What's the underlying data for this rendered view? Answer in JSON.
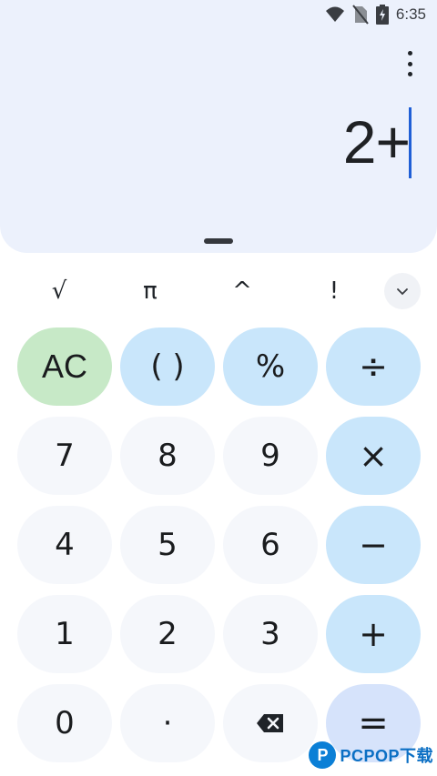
{
  "status_bar": {
    "time": "6:35",
    "icons": [
      "wifi-icon",
      "no-sim-icon",
      "battery-charging-icon"
    ]
  },
  "display": {
    "expression": "2+",
    "menu_icon": "overflow-menu-icon"
  },
  "scientific_row": {
    "keys": [
      "√",
      "π",
      "^",
      "!"
    ],
    "expand_icon": "chevron-down-icon"
  },
  "keypad": {
    "rows": [
      [
        "AC",
        "( )",
        "%",
        "÷"
      ],
      [
        "7",
        "8",
        "9",
        "×"
      ],
      [
        "4",
        "5",
        "6",
        "−"
      ],
      [
        "1",
        "2",
        "3",
        "+"
      ],
      [
        "0",
        "·",
        "backspace-icon",
        "="
      ]
    ]
  },
  "watermark": {
    "logo_letter": "P",
    "text": "PCPOP下载"
  },
  "colors": {
    "display_bg": "#ecf1fc",
    "digit_key": "#f5f7fb",
    "operator_key": "#c9e6fb",
    "clear_key": "#c7e9c7",
    "equals_key": "#d6e3fb",
    "cursor": "#1f5fd6"
  }
}
